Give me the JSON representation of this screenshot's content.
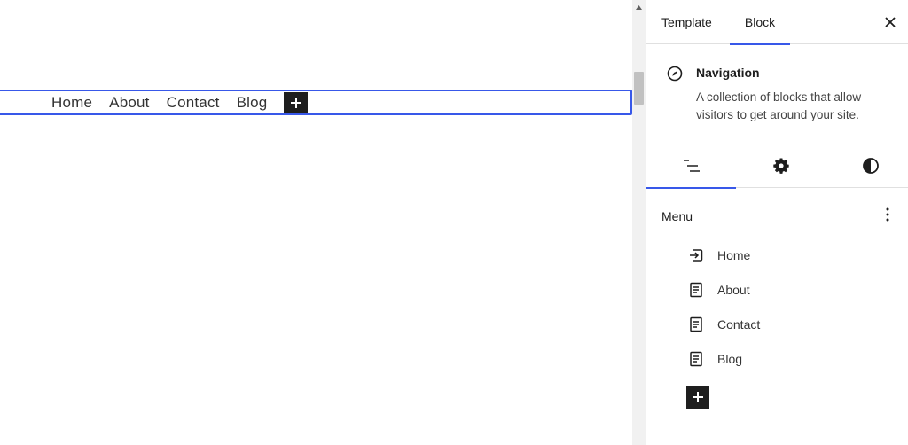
{
  "canvas": {
    "nav_links": [
      "Home",
      "About",
      "Contact",
      "Blog"
    ],
    "add_button_icon": "plus-icon"
  },
  "sidebar": {
    "tabs": [
      {
        "label": "Template"
      },
      {
        "label": "Block",
        "active": true
      }
    ],
    "close_icon": "close-icon",
    "block": {
      "icon": "compass-icon",
      "title": "Navigation",
      "description": "A collection of blocks that allow visitors to get around your site."
    },
    "inspector_tabs": [
      {
        "icon": "list-view-icon",
        "active": true
      },
      {
        "icon": "gear-icon"
      },
      {
        "icon": "contrast-icon"
      }
    ],
    "menu": {
      "label": "Menu",
      "more_icon": "vertical-ellipsis-icon",
      "items": [
        {
          "label": "Home",
          "icon": "home-link-icon"
        },
        {
          "label": "About",
          "icon": "page-icon"
        },
        {
          "label": "Contact",
          "icon": "page-icon"
        },
        {
          "label": "Blog",
          "icon": "page-icon"
        }
      ],
      "add_icon": "plus-icon"
    }
  },
  "colors": {
    "accent": "#3858e9",
    "dark": "#1e1e1e",
    "border": "#e0e0e0"
  }
}
